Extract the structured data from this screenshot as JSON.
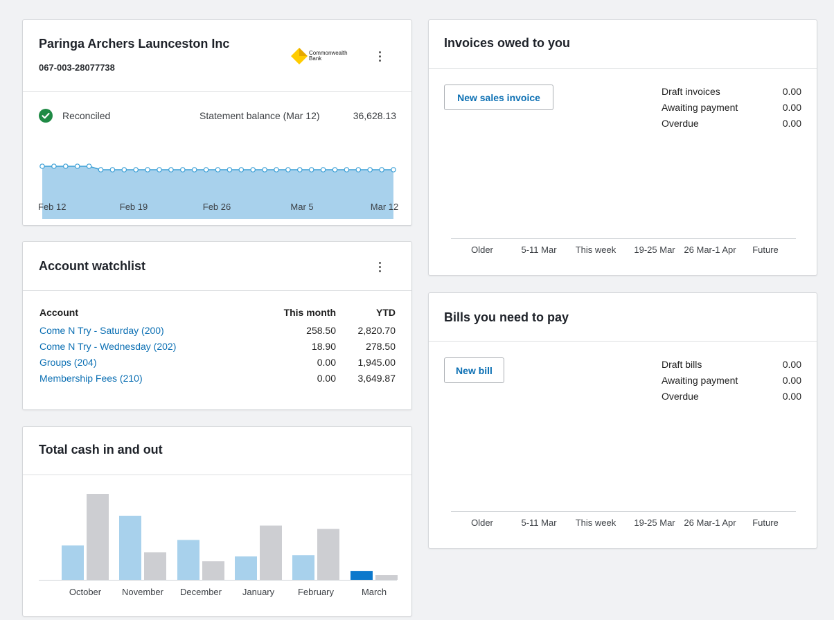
{
  "bank": {
    "org_name": "Paringa Archers Launceston Inc",
    "account_number": "067-003-28077738",
    "bank_logo_line1": "Commonwealth",
    "bank_logo_line2": "Bank",
    "reconciled_label": "Reconciled",
    "statement_label": "Statement balance (Mar 12)",
    "statement_value": "36,628.13",
    "x_labels": [
      "Feb 12",
      "Feb 19",
      "Feb 26",
      "Mar 5",
      "Mar 12"
    ],
    "balance_series": [
      36800,
      36800,
      36800,
      36800,
      36800,
      36628.13,
      36628.13,
      36628.13,
      36628.13,
      36628.13,
      36628.13,
      36628.13,
      36628.13,
      36628.13,
      36628.13,
      36628.13,
      36628.13,
      36628.13,
      36628.13,
      36628.13,
      36628.13,
      36628.13,
      36628.13,
      36628.13,
      36628.13,
      36628.13,
      36628.13,
      36628.13,
      36628.13,
      36628.13,
      36628.13
    ]
  },
  "watchlist": {
    "title": "Account watchlist",
    "headers": {
      "account": "Account",
      "month": "This month",
      "ytd": "YTD"
    },
    "rows": [
      {
        "account": "Come N Try - Saturday (200)",
        "month": "258.50",
        "ytd": "2,820.70"
      },
      {
        "account": "Come N Try - Wednesday (202)",
        "month": "18.90",
        "ytd": "278.50"
      },
      {
        "account": "Groups (204)",
        "month": "0.00",
        "ytd": "1,945.00"
      },
      {
        "account": "Membership Fees (210)",
        "month": "0.00",
        "ytd": "3,649.87"
      }
    ]
  },
  "cash": {
    "title": "Total cash in and out",
    "months": [
      "October",
      "November",
      "December",
      "January",
      "February",
      "March"
    ]
  },
  "invoices": {
    "title": "Invoices owed to you",
    "button": "New sales invoice",
    "summary": [
      {
        "label": "Draft invoices",
        "value": "0.00"
      },
      {
        "label": "Awaiting payment",
        "value": "0.00"
      },
      {
        "label": "Overdue",
        "value": "0.00"
      }
    ],
    "axis": [
      "Older",
      "5-11 Mar",
      "This week",
      "19-25 Mar",
      "26 Mar-1 Apr",
      "Future"
    ]
  },
  "bills": {
    "title": "Bills you need to pay",
    "button": "New bill",
    "summary": [
      {
        "label": "Draft bills",
        "value": "0.00"
      },
      {
        "label": "Awaiting payment",
        "value": "0.00"
      },
      {
        "label": "Overdue",
        "value": "0.00"
      }
    ],
    "axis": [
      "Older",
      "5-11 Mar",
      "This week",
      "19-25 Mar",
      "26 Mar-1 Apr",
      "Future"
    ]
  },
  "chart_data": [
    {
      "type": "area",
      "x": [
        "Feb 12",
        "Feb 19",
        "Feb 26",
        "Mar 5",
        "Mar 12"
      ],
      "series": [
        {
          "values": [
            36800,
            36628.13,
            36628.13,
            36628.13,
            36628.13
          ]
        }
      ],
      "colors": {
        "fill": "#a8d1ec",
        "line": "#3a9fd6"
      }
    },
    {
      "type": "bar",
      "categories": [
        "October",
        "November",
        "December",
        "January",
        "February",
        "March"
      ],
      "series": [
        {
          "values": [
            500,
            930,
            580,
            340,
            360,
            130
          ]
        },
        {
          "values": [
            1250,
            400,
            270,
            790,
            740,
            70
          ]
        }
      ],
      "colors": {
        "in": "#a8d1ec",
        "out": "#cdced2",
        "current": "#0b78cc"
      }
    }
  ]
}
